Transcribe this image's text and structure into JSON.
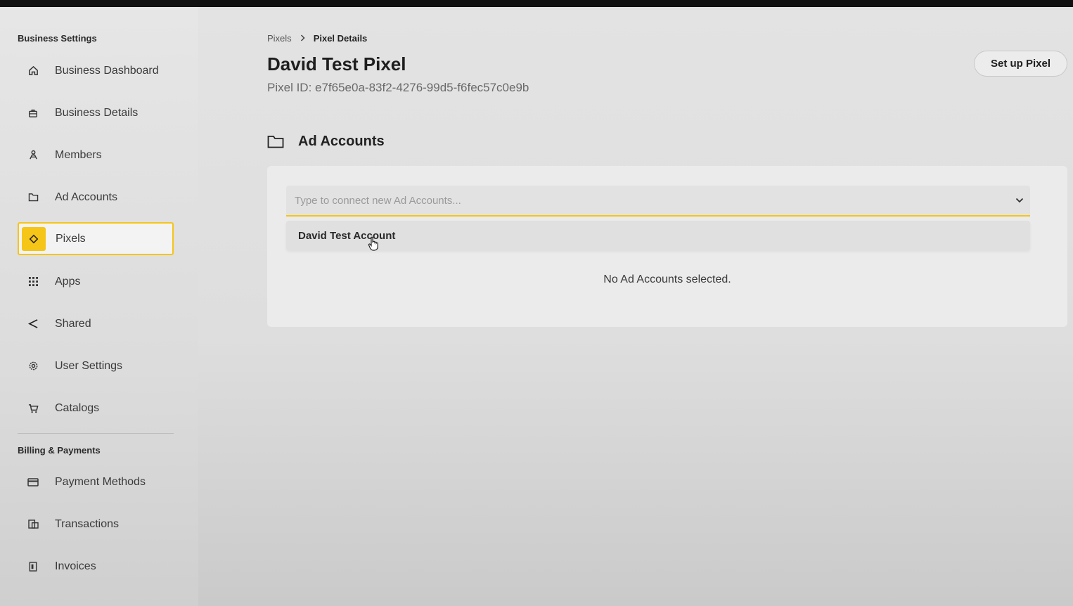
{
  "sidebar": {
    "business_settings_title": "Business Settings",
    "business_items": [
      {
        "label": "Business Dashboard",
        "icon": "home-icon"
      },
      {
        "label": "Business Details",
        "icon": "briefcase-icon"
      },
      {
        "label": "Members",
        "icon": "members-icon"
      },
      {
        "label": "Ad Accounts",
        "icon": "folder-icon"
      },
      {
        "label": "Pixels",
        "icon": "diamond-icon",
        "active": true
      },
      {
        "label": "Apps",
        "icon": "grid-icon"
      },
      {
        "label": "Shared",
        "icon": "share-icon"
      },
      {
        "label": "User Settings",
        "icon": "gear-icon"
      },
      {
        "label": "Catalogs",
        "icon": "cart-icon"
      }
    ],
    "billing_title": "Billing & Payments",
    "billing_items": [
      {
        "label": "Payment Methods",
        "icon": "card-icon"
      },
      {
        "label": "Transactions",
        "icon": "transactions-icon"
      },
      {
        "label": "Invoices",
        "icon": "invoice-icon"
      }
    ]
  },
  "breadcrumb": {
    "parent": "Pixels",
    "current": "Pixel Details"
  },
  "page": {
    "title": "David Test Pixel",
    "pixel_id": "Pixel ID: e7f65e0a-83f2-4276-99d5-f6fec57c0e9b",
    "setup_button": "Set up Pixel"
  },
  "ad_accounts": {
    "header": "Ad Accounts",
    "input_placeholder": "Type to connect new Ad Accounts...",
    "dropdown_options": [
      "David Test Account"
    ],
    "empty_text": "No Ad Accounts selected."
  },
  "colors": {
    "accent": "#f5c518",
    "sidebar_bg": "#e6e6e6",
    "main_bg": "#e3e3e3"
  }
}
